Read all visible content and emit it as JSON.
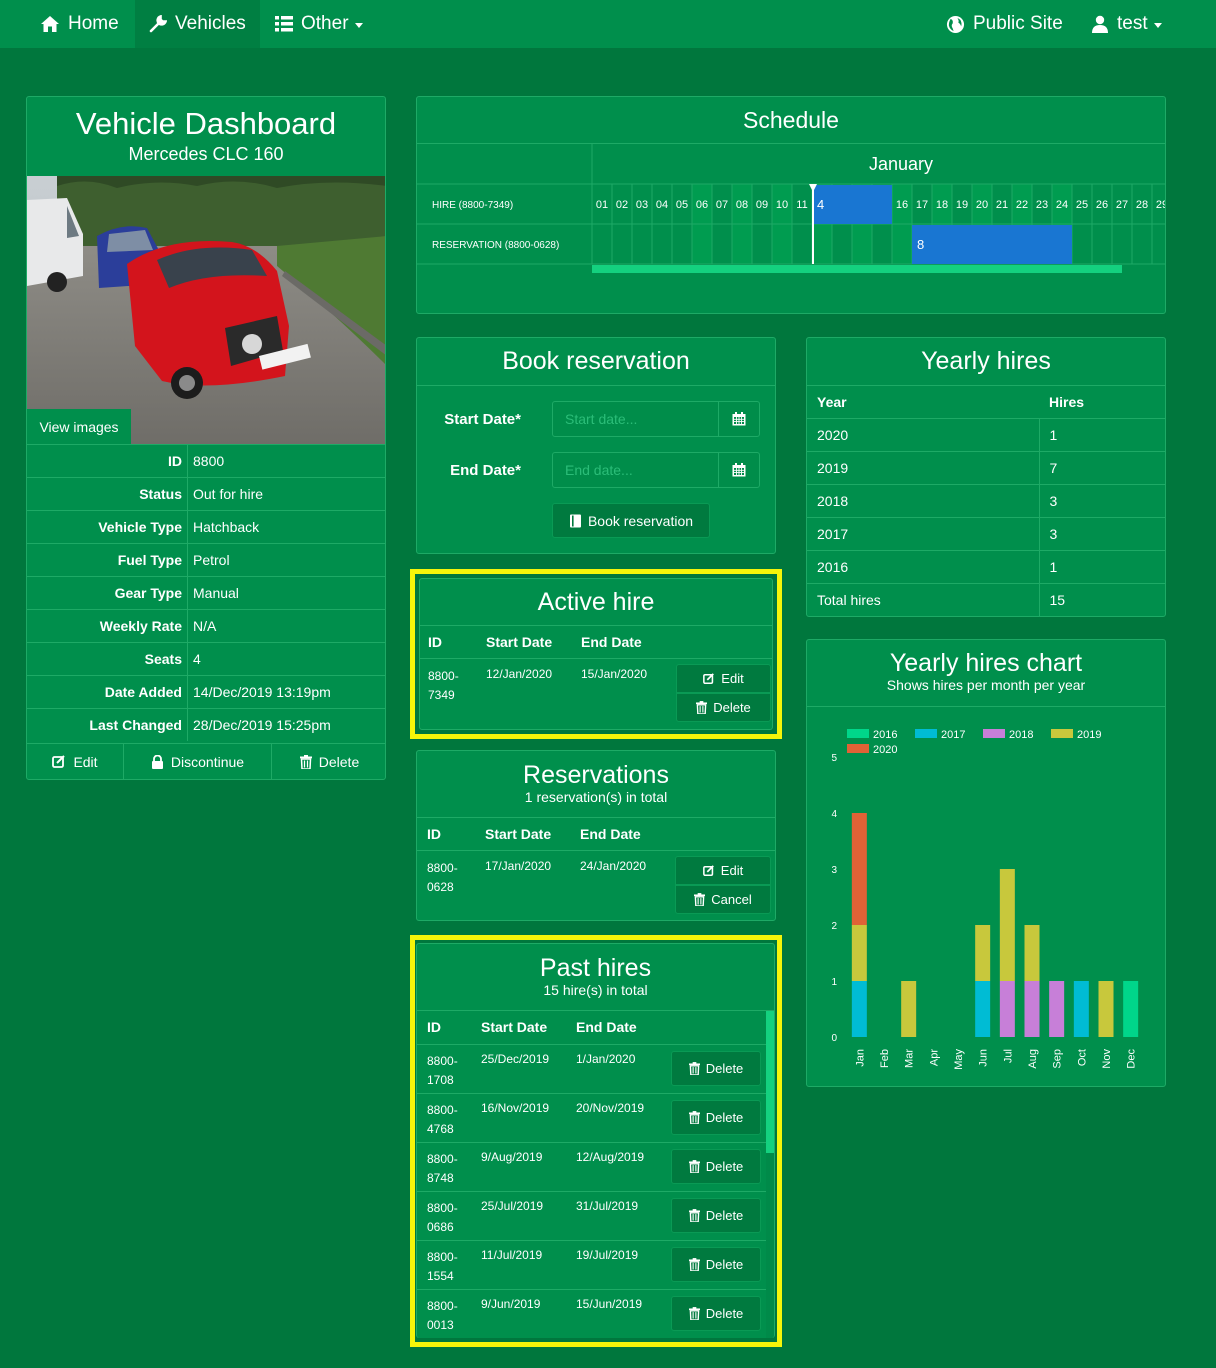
{
  "nav": {
    "home": "Home",
    "vehicles": "Vehicles",
    "other": "Other",
    "public_site": "Public Site",
    "user": "test"
  },
  "vehicle": {
    "title": "Vehicle Dashboard",
    "subtitle": "Mercedes CLC 160",
    "view_images": "View images",
    "fields": [
      {
        "label": "ID",
        "value": "8800"
      },
      {
        "label": "Status",
        "value": "Out for hire"
      },
      {
        "label": "Vehicle Type",
        "value": "Hatchback"
      },
      {
        "label": "Fuel Type",
        "value": "Petrol"
      },
      {
        "label": "Gear Type",
        "value": "Manual"
      },
      {
        "label": "Weekly Rate",
        "value": "N/A"
      },
      {
        "label": "Seats",
        "value": "4"
      },
      {
        "label": "Date Added",
        "value": "14/Dec/2019 13:19pm"
      },
      {
        "label": "Last Changed",
        "value": "28/Dec/2019 15:25pm"
      }
    ],
    "actions": {
      "edit": "Edit",
      "discontinue": "Discontinue",
      "delete": "Delete"
    }
  },
  "schedule": {
    "title": "Schedule",
    "month": "January",
    "days": [
      "01",
      "02",
      "03",
      "04",
      "05",
      "06",
      "07",
      "08",
      "09",
      "10",
      "11",
      "12",
      "13",
      "14",
      "15",
      "16",
      "17",
      "18",
      "19",
      "20",
      "21",
      "22",
      "23",
      "24",
      "25",
      "26",
      "27",
      "28",
      "29"
    ],
    "rows": [
      {
        "label": "HIRE (8800-7349)",
        "count": "4",
        "start_day": 12,
        "end_day": 15
      },
      {
        "label": "RESERVATION (8800-0628)",
        "count": "8",
        "start_day": 17,
        "end_day": 24
      }
    ],
    "today_day": 12
  },
  "book": {
    "title": "Book reservation",
    "start_label": "Start Date*",
    "start_placeholder": "Start date...",
    "end_label": "End Date*",
    "end_placeholder": "End date...",
    "button": "Book reservation"
  },
  "yearly": {
    "title": "Yearly hires",
    "headers": [
      "Year",
      "Hires"
    ],
    "rows": [
      {
        "year": "2020",
        "hires": "1"
      },
      {
        "year": "2019",
        "hires": "7"
      },
      {
        "year": "2018",
        "hires": "3"
      },
      {
        "year": "2017",
        "hires": "3"
      },
      {
        "year": "2016",
        "hires": "1"
      },
      {
        "year": "Total hires",
        "hires": "15"
      }
    ]
  },
  "active": {
    "title": "Active hire",
    "headers": [
      "ID",
      "Start Date",
      "End Date"
    ],
    "row": {
      "id_a": "8800-",
      "id_b": "7349",
      "start": "12/Jan/2020",
      "end": "15/Jan/2020",
      "edit": "Edit",
      "delete": "Delete"
    }
  },
  "reservations": {
    "title": "Reservations",
    "subtitle": "1 reservation(s) in total",
    "headers": [
      "ID",
      "Start Date",
      "End Date"
    ],
    "row": {
      "id_a": "8800-",
      "id_b": "0628",
      "start": "17/Jan/2020",
      "end": "24/Jan/2020",
      "edit": "Edit",
      "cancel": "Cancel"
    }
  },
  "past": {
    "title": "Past hires",
    "subtitle": "15 hire(s) in total",
    "headers": [
      "ID",
      "Start Date",
      "End Date"
    ],
    "delete_label": "Delete",
    "rows": [
      {
        "id_a": "8800-",
        "id_b": "1708",
        "start": "25/Dec/2019",
        "end": "1/Jan/2020"
      },
      {
        "id_a": "8800-",
        "id_b": "4768",
        "start": "16/Nov/2019",
        "end": "20/Nov/2019"
      },
      {
        "id_a": "8800-",
        "id_b": "8748",
        "start": "9/Aug/2019",
        "end": "12/Aug/2019"
      },
      {
        "id_a": "8800-",
        "id_b": "0686",
        "start": "25/Jul/2019",
        "end": "31/Jul/2019"
      },
      {
        "id_a": "8800-",
        "id_b": "1554",
        "start": "11/Jul/2019",
        "end": "19/Jul/2019"
      },
      {
        "id_a": "8800-",
        "id_b": "0013",
        "start": "9/Jun/2019",
        "end": "15/Jun/2019"
      }
    ]
  },
  "chart_data": {
    "type": "bar",
    "title": "Yearly hires chart",
    "subtitle": "Shows hires per month per year",
    "categories": [
      "Jan",
      "Feb",
      "Mar",
      "Apr",
      "May",
      "Jun",
      "Jul",
      "Aug",
      "Sep",
      "Oct",
      "Nov",
      "Dec"
    ],
    "series": [
      {
        "name": "2016",
        "color": "#00d68a",
        "values": [
          0,
          0,
          0,
          0,
          0,
          0,
          0,
          0,
          0,
          0,
          0,
          1
        ]
      },
      {
        "name": "2017",
        "color": "#00bcd4",
        "values": [
          1,
          0,
          0,
          0,
          0,
          1,
          0,
          0,
          0,
          1,
          0,
          0
        ]
      },
      {
        "name": "2018",
        "color": "#c77fd8",
        "values": [
          0,
          0,
          0,
          0,
          0,
          0,
          1,
          1,
          1,
          0,
          0,
          0
        ]
      },
      {
        "name": "2019",
        "color": "#c8c83c",
        "values": [
          1,
          0,
          1,
          0,
          0,
          1,
          2,
          1,
          0,
          0,
          1,
          0
        ]
      },
      {
        "name": "2020",
        "color": "#e06236",
        "values": [
          2,
          0,
          0,
          0,
          0,
          0,
          0,
          0,
          0,
          0,
          0,
          0
        ]
      }
    ],
    "ylim": [
      0,
      5
    ],
    "yticks": [
      "0",
      "1",
      "2",
      "3",
      "4",
      "5"
    ],
    "stacked": true,
    "legend": "top",
    "grid": false
  },
  "colors": {
    "background": "#00773d",
    "panel": "#008f4c",
    "bar_blue": "#1976d2",
    "highlight": "#f5f50a"
  }
}
